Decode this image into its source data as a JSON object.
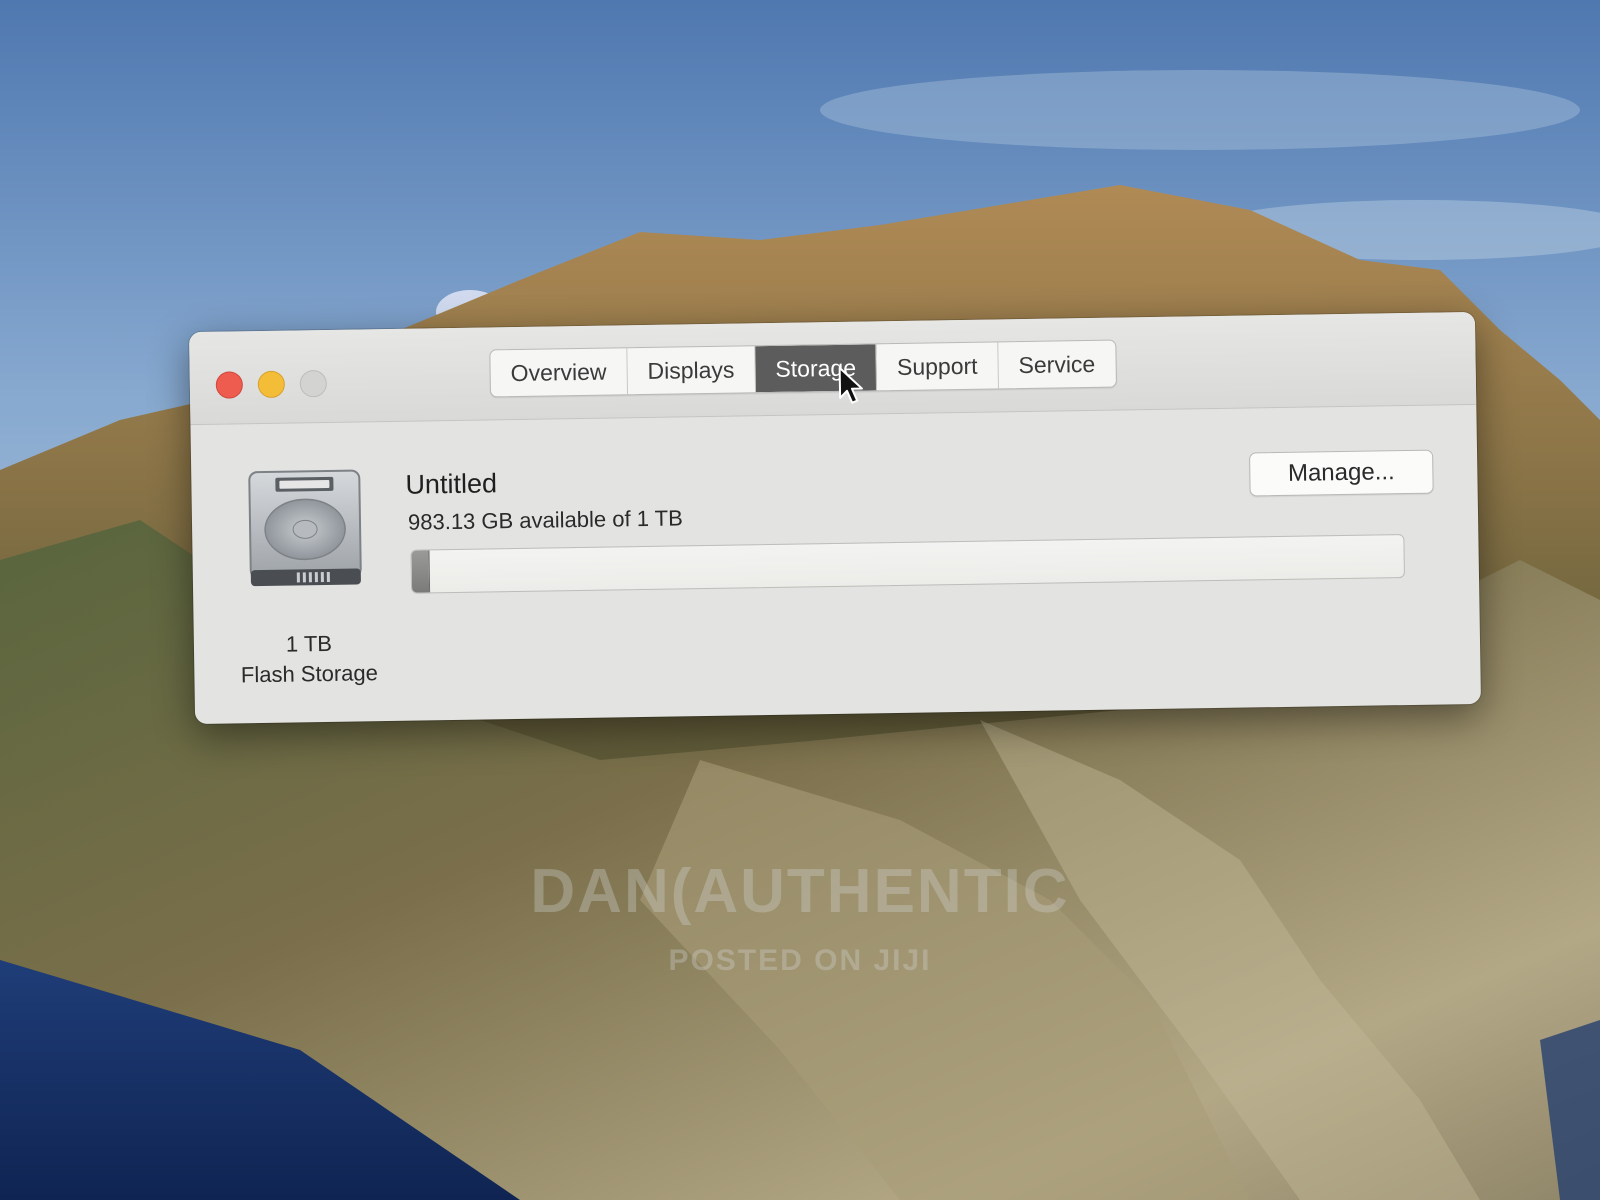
{
  "window": {
    "tabs": [
      {
        "label": "Overview",
        "active": false
      },
      {
        "label": "Displays",
        "active": false
      },
      {
        "label": "Storage",
        "active": true
      },
      {
        "label": "Support",
        "active": false
      },
      {
        "label": "Service",
        "active": false
      }
    ]
  },
  "disk": {
    "icon": "hard-drive-icon",
    "size_label": "1 TB",
    "type_label": "Flash Storage"
  },
  "volume": {
    "name": "Untitled",
    "available_text": "983.13 GB available of 1 TB",
    "available_gb": 983.13,
    "total_tb": 1,
    "used_fraction": 0.017
  },
  "actions": {
    "manage_label": "Manage..."
  },
  "watermark": {
    "line1": "DAN(AUTHENTIC",
    "line2": "POSTED ON JIJI"
  },
  "colors": {
    "close": "#ee5b4f",
    "minimize": "#f4bd38",
    "zoom_disabled": "#d3d3d1",
    "active_tab": "#5c5c5c"
  }
}
